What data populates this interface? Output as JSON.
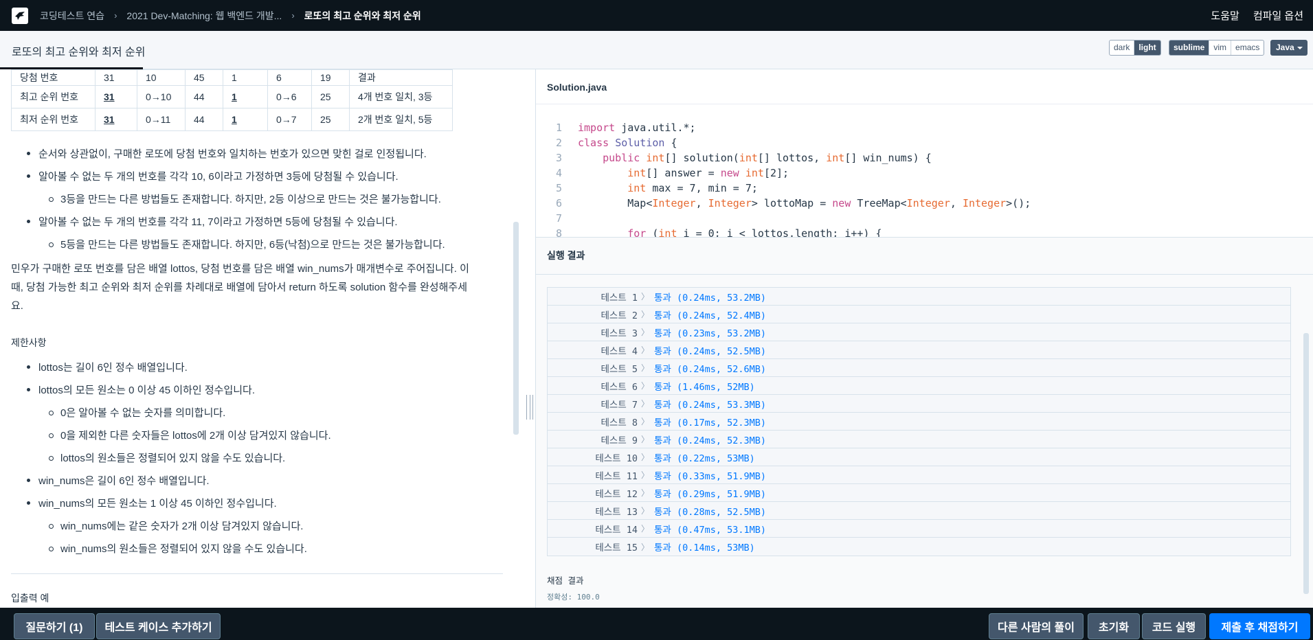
{
  "nav": {
    "breadcrumb": [
      "코딩테스트 연습",
      "2021 Dev-Matching: 웹 백엔드 개발...",
      "로또의 최고 순위와 최저 순위"
    ],
    "help": "도움말",
    "compile_options": "컴파일 옵션"
  },
  "title": "로또의 최고 순위와 최저 순위",
  "theme": {
    "dark": "dark",
    "light": "light",
    "active": "light"
  },
  "keymap": {
    "sublime": "sublime",
    "vim": "vim",
    "emacs": "emacs",
    "active": "sublime"
  },
  "language": "Java",
  "lotto_table": {
    "rows": [
      [
        "당첨 번호",
        "31",
        "10",
        "45",
        "1",
        "6",
        "19",
        "결과"
      ],
      [
        "최고 순위 번호",
        "31",
        "0→10",
        "44",
        "1",
        "0→6",
        "25",
        "4개 번호 일치, 3등"
      ],
      [
        "최저 순위 번호",
        "31",
        "0→11",
        "44",
        "1",
        "0→7",
        "25",
        "2개 번호 일치, 5등"
      ]
    ]
  },
  "description": {
    "bullets": [
      "순서와 상관없이, 구매한 로또에 당첨 번호와 일치하는 번호가 있으면 맞힌 걸로 인정됩니다.",
      "알아볼 수 없는 두 개의 번호를 각각 10, 6이라고 가정하면 3등에 당첨될 수 있습니다.",
      "3등을 만드는 다른 방법들도 존재합니다. 하지만, 2등 이상으로 만드는 것은 불가능합니다.",
      "알아볼 수 없는 두 개의 번호를 각각 11, 7이라고 가정하면 5등에 당첨될 수 있습니다.",
      "5등을 만드는 다른 방법들도 존재합니다. 하지만, 6등(낙첨)으로 만드는 것은 불가능합니다."
    ],
    "para_line1": "민우가 구매한 로또 번호를 담은 배열 lottos, 당첨 번호를 담은 배열 win_nums가 매개변수로 주어집니다. 이",
    "para_line2": "때, 당첨 가능한 최고 순위와 최저 순위를 차례대로 배열에 담아서 return 하도록 solution 함수를 완성해주세",
    "para_line3": "요."
  },
  "constraints": {
    "heading": "제한사항",
    "items": [
      "lottos는 길이 6인 정수 배열입니다.",
      "lottos의 모든 원소는 0 이상 45 이하인 정수입니다.",
      "0은 알아볼 수 없는 숫자를 의미합니다.",
      "0을 제외한 다른 숫자들은 lottos에 2개 이상 담겨있지 않습니다.",
      "lottos의 원소들은 정렬되어 있지 않을 수도 있습니다.",
      "win_nums은 길이 6인 정수 배열입니다.",
      "win_nums의 모든 원소는 1 이상 45 이하인 정수입니다.",
      "win_nums에는 같은 숫자가 2개 이상 담겨있지 않습니다.",
      "win_nums의 원소들은 정렬되어 있지 않을 수도 있습니다."
    ]
  },
  "io_heading": "입출력 예",
  "editor": {
    "filename": "Solution.java",
    "lines": [
      "import java.util.*;",
      "class Solution {",
      "    public int[] solution(int[] lottos, int[] win_nums) {",
      "        int[] answer = new int[2];",
      "        int max = 7, min = 7;",
      "        Map<Integer, Integer> lottoMap = new TreeMap<Integer, Integer>();",
      "",
      "        for (int i = 0; i < lottos.length; i++) {"
    ]
  },
  "results": {
    "title": "실행 결과",
    "tests": [
      {
        "name": "테스트 1",
        "result": "통과 (0.24ms, 53.2MB)"
      },
      {
        "name": "테스트 2",
        "result": "통과 (0.24ms, 52.4MB)"
      },
      {
        "name": "테스트 3",
        "result": "통과 (0.23ms, 53.2MB)"
      },
      {
        "name": "테스트 4",
        "result": "통과 (0.24ms, 52.5MB)"
      },
      {
        "name": "테스트 5",
        "result": "통과 (0.24ms, 52.6MB)"
      },
      {
        "name": "테스트 6",
        "result": "통과 (1.46ms, 52MB)"
      },
      {
        "name": "테스트 7",
        "result": "통과 (0.24ms, 53.3MB)"
      },
      {
        "name": "테스트 8",
        "result": "통과 (0.17ms, 52.3MB)"
      },
      {
        "name": "테스트 9",
        "result": "통과 (0.24ms, 52.3MB)"
      },
      {
        "name": "테스트 10",
        "result": "통과 (0.22ms, 53MB)"
      },
      {
        "name": "테스트 11",
        "result": "통과 (0.33ms, 51.9MB)"
      },
      {
        "name": "테스트 12",
        "result": "통과 (0.29ms, 51.9MB)"
      },
      {
        "name": "테스트 13",
        "result": "통과 (0.28ms, 52.5MB)"
      },
      {
        "name": "테스트 14",
        "result": "통과 (0.47ms, 53.1MB)"
      },
      {
        "name": "테스트 15",
        "result": "통과 (0.14ms, 53MB)"
      }
    ],
    "grade_title": "채점 결과",
    "accuracy": "정확성: 100.0"
  },
  "bottom": {
    "ask": "질문하기 (1)",
    "add_testcase": "테스트 케이스 추가하기",
    "others": "다른 사람의 풀이",
    "reset": "초기화",
    "run": "코드 실행",
    "submit": "제출 후 채점하기"
  },
  "colors": {
    "nav_bg": "#0c151c",
    "primary": "#0078ff",
    "pass": "#0078ff",
    "keyword": "#c5488b",
    "type": "#e66a31"
  }
}
